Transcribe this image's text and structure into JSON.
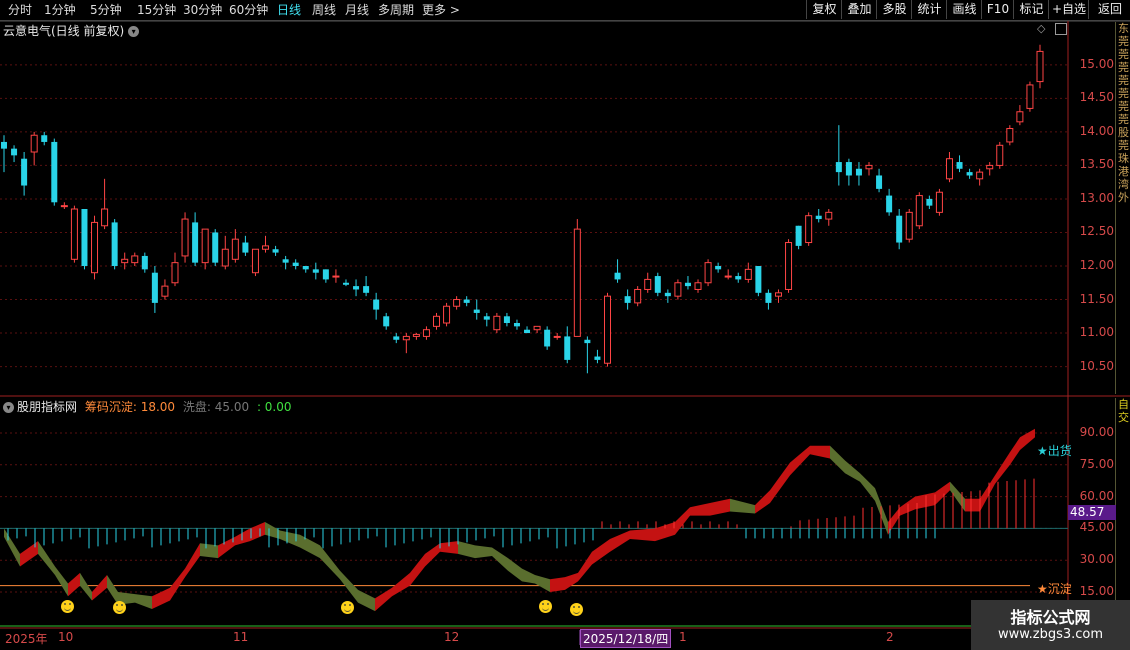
{
  "toolbar": {
    "periods": [
      "分时",
      "1分钟",
      "5分钟",
      "15分钟",
      "30分钟",
      "60分钟",
      "日线",
      "周线",
      "月线",
      "多周期",
      "更多 >"
    ],
    "active_period": "日线",
    "right_buttons": [
      "复权",
      "叠加",
      "多股",
      "统计",
      "画线",
      "F10",
      "标记",
      "+自选",
      "返回"
    ]
  },
  "chart_title": "云意电气(日线 前复权)",
  "indicator": {
    "name": "股朋指标网",
    "chip_label": "筹码沉淀: 18.00",
    "wash_label": "洗盘: 45.00",
    "third_label": ": 0.00",
    "current_value_label": "48.57",
    "signal_top": "★出货",
    "signal_bottom": "★沉淀"
  },
  "price_axis_labels": [
    "15.00",
    "14.50",
    "14.00",
    "13.50",
    "13.00",
    "12.50",
    "12.00",
    "11.50",
    "11.00",
    "10.50"
  ],
  "indicator_axis_labels": [
    "90.00",
    "75.00",
    "60.00",
    "45.00",
    "30.00",
    "15.00"
  ],
  "x_axis_labels": [
    "2025年",
    "10",
    "11",
    "12",
    "1",
    "2"
  ],
  "cursor_date": "2025/12/18/四",
  "side_text_top": "东莞莞莞莞莞莞莞股莞珠港湾外",
  "side_text_bottom": "自交",
  "watermark": {
    "line1": "指标公式网",
    "line2": "www.zbgs3.com"
  },
  "colors": {
    "up": "#ff4545",
    "down": "#2ad4e8",
    "up_fill": "#c41212",
    "down_fill": "#5a6e2e",
    "accent": "#ffd21a",
    "bg": "#000000"
  },
  "chart_data": {
    "type": "candlestick",
    "title": "云意电气(日线 前复权)",
    "ylim": [
      10.3,
      15.4
    ],
    "candles": [
      [
        13.85,
        13.95,
        13.4,
        13.75
      ],
      [
        13.75,
        13.8,
        13.55,
        13.65
      ],
      [
        13.6,
        13.7,
        13.05,
        13.2
      ],
      [
        13.7,
        14.0,
        13.5,
        13.95
      ],
      [
        13.95,
        14.0,
        13.8,
        13.85
      ],
      [
        13.85,
        13.9,
        12.9,
        12.95
      ],
      [
        12.9,
        12.95,
        12.85,
        12.9
      ],
      [
        12.1,
        12.9,
        12.05,
        12.85
      ],
      [
        12.85,
        12.85,
        11.95,
        12.0
      ],
      [
        11.9,
        12.75,
        11.8,
        12.65
      ],
      [
        12.6,
        13.3,
        12.55,
        12.85
      ],
      [
        12.65,
        12.7,
        11.95,
        12.0
      ],
      [
        12.05,
        12.2,
        11.95,
        12.1
      ],
      [
        12.05,
        12.2,
        12.0,
        12.15
      ],
      [
        12.15,
        12.2,
        11.9,
        11.95
      ],
      [
        11.9,
        12.0,
        11.3,
        11.45
      ],
      [
        11.55,
        11.8,
        11.5,
        11.7
      ],
      [
        11.75,
        12.2,
        11.7,
        12.05
      ],
      [
        12.15,
        12.8,
        12.05,
        12.7
      ],
      [
        12.65,
        12.8,
        12.0,
        12.05
      ],
      [
        12.05,
        12.55,
        11.95,
        12.55
      ],
      [
        12.5,
        12.55,
        12.0,
        12.05
      ],
      [
        12.0,
        12.45,
        11.95,
        12.25
      ],
      [
        12.1,
        12.55,
        12.05,
        12.4
      ],
      [
        12.35,
        12.45,
        12.15,
        12.2
      ],
      [
        11.9,
        12.25,
        11.85,
        12.25
      ],
      [
        12.25,
        12.45,
        12.2,
        12.3
      ],
      [
        12.25,
        12.3,
        12.15,
        12.2
      ],
      [
        12.1,
        12.15,
        11.95,
        12.05
      ],
      [
        12.05,
        12.1,
        11.95,
        12.0
      ],
      [
        12.0,
        12.0,
        11.9,
        11.95
      ],
      [
        11.95,
        12.05,
        11.8,
        11.9
      ],
      [
        11.95,
        11.95,
        11.75,
        11.8
      ],
      [
        11.85,
        11.95,
        11.75,
        11.85
      ],
      [
        11.75,
        11.8,
        11.7,
        11.72
      ],
      [
        11.7,
        11.8,
        11.55,
        11.65
      ],
      [
        11.7,
        11.85,
        11.55,
        11.6
      ],
      [
        11.5,
        11.6,
        11.2,
        11.35
      ],
      [
        11.25,
        11.3,
        11.05,
        11.1
      ],
      [
        10.95,
        11.0,
        10.85,
        10.9
      ],
      [
        10.9,
        11.0,
        10.7,
        10.95
      ],
      [
        10.95,
        11.0,
        10.9,
        10.98
      ],
      [
        10.95,
        11.1,
        10.9,
        11.05
      ],
      [
        11.1,
        11.3,
        11.05,
        11.25
      ],
      [
        11.15,
        11.45,
        11.1,
        11.4
      ],
      [
        11.4,
        11.55,
        11.35,
        11.5
      ],
      [
        11.5,
        11.55,
        11.4,
        11.45
      ],
      [
        11.35,
        11.5,
        11.2,
        11.3
      ],
      [
        11.25,
        11.3,
        11.1,
        11.2
      ],
      [
        11.05,
        11.3,
        11.0,
        11.25
      ],
      [
        11.25,
        11.3,
        11.1,
        11.15
      ],
      [
        11.15,
        11.2,
        11.05,
        11.1
      ],
      [
        11.05,
        11.1,
        11.0,
        11.0
      ],
      [
        11.05,
        11.1,
        11.0,
        11.1
      ],
      [
        11.05,
        11.1,
        10.75,
        10.8
      ],
      [
        10.95,
        11.0,
        10.9,
        10.95
      ],
      [
        10.95,
        11.1,
        10.55,
        10.6
      ],
      [
        10.95,
        12.7,
        10.95,
        12.55
      ],
      [
        10.9,
        10.95,
        10.4,
        10.85
      ],
      [
        10.65,
        10.75,
        10.55,
        10.6
      ],
      [
        10.55,
        11.6,
        10.5,
        11.55
      ],
      [
        11.9,
        12.1,
        11.75,
        11.8
      ],
      [
        11.55,
        11.65,
        11.35,
        11.45
      ],
      [
        11.45,
        11.7,
        11.4,
        11.65
      ],
      [
        11.65,
        11.9,
        11.6,
        11.8
      ],
      [
        11.85,
        11.9,
        11.55,
        11.6
      ],
      [
        11.6,
        11.65,
        11.45,
        11.55
      ],
      [
        11.55,
        11.8,
        11.5,
        11.75
      ],
      [
        11.75,
        11.85,
        11.65,
        11.7
      ],
      [
        11.65,
        11.8,
        11.6,
        11.75
      ],
      [
        11.75,
        12.1,
        11.7,
        12.05
      ],
      [
        12.0,
        12.05,
        11.9,
        11.95
      ],
      [
        11.85,
        11.95,
        11.8,
        11.85
      ],
      [
        11.85,
        11.9,
        11.75,
        11.8
      ],
      [
        11.8,
        12.05,
        11.75,
        11.95
      ],
      [
        12.0,
        12.0,
        11.55,
        11.6
      ],
      [
        11.6,
        11.65,
        11.35,
        11.45
      ],
      [
        11.55,
        11.65,
        11.45,
        11.6
      ],
      [
        11.65,
        12.4,
        11.6,
        12.35
      ],
      [
        12.6,
        12.6,
        12.25,
        12.3
      ],
      [
        12.35,
        12.8,
        12.3,
        12.75
      ],
      [
        12.75,
        12.85,
        12.65,
        12.7
      ],
      [
        12.7,
        12.85,
        12.6,
        12.8
      ],
      [
        13.55,
        14.1,
        13.2,
        13.4
      ],
      [
        13.55,
        13.6,
        13.2,
        13.35
      ],
      [
        13.45,
        13.55,
        13.2,
        13.35
      ],
      [
        13.45,
        13.55,
        13.35,
        13.5
      ],
      [
        13.35,
        13.45,
        13.1,
        13.15
      ],
      [
        13.05,
        13.15,
        12.75,
        12.8
      ],
      [
        12.75,
        12.85,
        12.25,
        12.35
      ],
      [
        12.4,
        12.85,
        12.35,
        12.8
      ],
      [
        12.6,
        13.1,
        12.55,
        13.05
      ],
      [
        13.0,
        13.05,
        12.85,
        12.9
      ],
      [
        12.8,
        13.15,
        12.75,
        13.1
      ],
      [
        13.3,
        13.7,
        13.25,
        13.6
      ],
      [
        13.55,
        13.65,
        13.4,
        13.45
      ],
      [
        13.4,
        13.45,
        13.3,
        13.35
      ],
      [
        13.3,
        13.45,
        13.2,
        13.4
      ],
      [
        13.45,
        13.55,
        13.35,
        13.5
      ],
      [
        13.5,
        13.85,
        13.45,
        13.8
      ],
      [
        13.85,
        14.1,
        13.8,
        14.05
      ],
      [
        14.15,
        14.4,
        14.1,
        14.3
      ],
      [
        14.35,
        14.75,
        14.3,
        14.7
      ],
      [
        14.75,
        15.3,
        14.65,
        15.2
      ]
    ]
  }
}
